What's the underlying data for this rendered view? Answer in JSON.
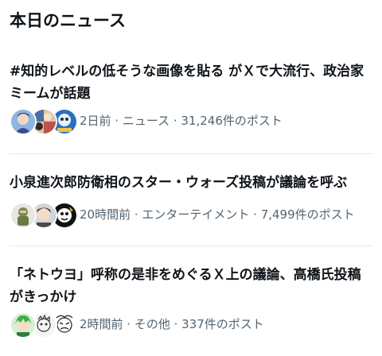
{
  "header": {
    "title": "本日のニュース"
  },
  "items": [
    {
      "title": "#知的レベルの低そうな画像を貼る がＸで大流行、政治家ミームが話題",
      "meta": "2日前 · ニュース · 31,246件のポスト",
      "avatars": [
        "avatar-anime-character",
        "avatar-collage",
        "avatar-blue-photo"
      ]
    },
    {
      "title": "小泉進次郎防衛相のスター・ウォーズ投稿が議論を呼ぶ",
      "meta": "20時間前 · エンターテイメント · 7,499件のポスト",
      "avatars": [
        "avatar-soldier",
        "avatar-anime-character",
        "avatar-cartoon-dark"
      ]
    },
    {
      "title": "「ネトウヨ」呼称の是非をめぐるＸ上の議論、高橋氏投稿がきっかけ",
      "meta": "2時間前 · その他 · 337件のポスト",
      "avatars": [
        "avatar-green-hair",
        "avatar-sketch-character",
        "avatar-monochrome-character"
      ]
    }
  ],
  "colors": {
    "text": "#0f1419",
    "muted": "#536471",
    "divider": "#e4e7ea",
    "background": "#ffffff"
  }
}
